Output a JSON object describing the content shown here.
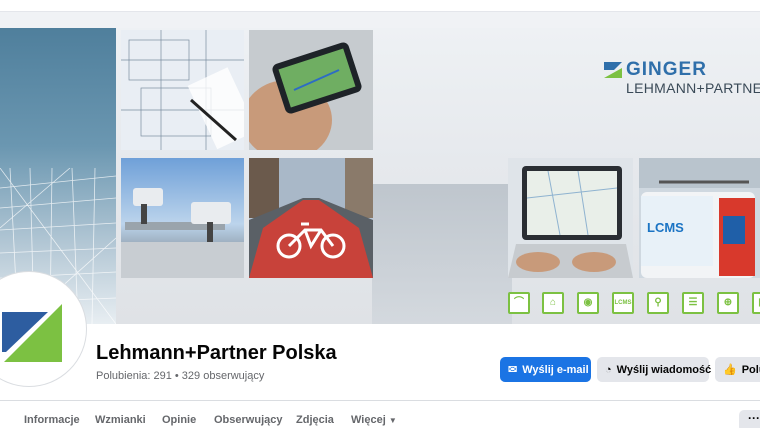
{
  "cover": {
    "logo": {
      "brand": "GINGER",
      "subbrand": "LEHMANN+PARTNER"
    },
    "van_label": "LCMS",
    "icon_badges": [
      "",
      "",
      "",
      "LCMS",
      "",
      "",
      "",
      ""
    ]
  },
  "profile": {
    "name": "Lehmann+Partner Polska",
    "stats": "Polubienia: 291 • 329 obserwujący"
  },
  "actions": {
    "email_label": "Wyślij e-mail",
    "message_label": "Wyślij wiadomość",
    "like_label": "Polub"
  },
  "tabs": {
    "items": [
      "Informacje",
      "Wzmianki",
      "Opinie",
      "Obserwujący",
      "Zdjęcia",
      "Więcej"
    ],
    "more_label": "···"
  },
  "colors": {
    "accent": "#1b74e4",
    "brand_green": "#7cc142",
    "brand_blue": "#2f6faa"
  }
}
